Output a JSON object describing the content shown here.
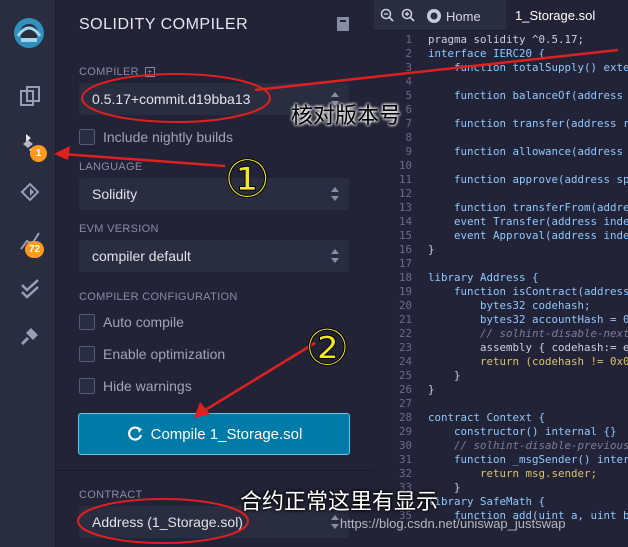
{
  "rail": {
    "badges": {
      "compiler": "1",
      "analysis": "72"
    }
  },
  "panel": {
    "title": "SOLIDITY COMPILER",
    "compiler_label": "COMPILER",
    "compiler_value": "0.5.17+commit.d19bba13",
    "nightly_label": "Include nightly builds",
    "language_label": "LANGUAGE",
    "language_value": "Solidity",
    "evm_label": "EVM VERSION",
    "evm_value": "compiler default",
    "config_label": "COMPILER CONFIGURATION",
    "auto_compile": "Auto compile",
    "optimization": "Enable optimization",
    "hide_warnings": "Hide warnings",
    "compile_button": "Compile 1_Storage.sol",
    "contract_label": "CONTRACT",
    "contract_value": "Address (1_Storage.sol)"
  },
  "editor": {
    "home_tab": "Home",
    "active_tab": "1_Storage.sol",
    "lines": [
      {
        "n": "1",
        "text": "pragma solidity ^0.5.17;",
        "cls": "t"
      },
      {
        "n": "2",
        "text": "interface IERC20 {",
        "cls": "k"
      },
      {
        "n": "3",
        "text": "    function totalSupply() exte",
        "cls": "k"
      },
      {
        "n": "4",
        "text": "",
        "cls": "t"
      },
      {
        "n": "5",
        "text": "    function balanceOf(address",
        "cls": "k"
      },
      {
        "n": "6",
        "text": "",
        "cls": "t"
      },
      {
        "n": "7",
        "text": "    function transfer(address r",
        "cls": "k"
      },
      {
        "n": "8",
        "text": "",
        "cls": "t"
      },
      {
        "n": "9",
        "text": "    function allowance(address",
        "cls": "k"
      },
      {
        "n": "10",
        "text": "",
        "cls": "t"
      },
      {
        "n": "11",
        "text": "    function approve(address sp",
        "cls": "k"
      },
      {
        "n": "12",
        "text": "",
        "cls": "t"
      },
      {
        "n": "13",
        "text": "    function transferFrom(addre",
        "cls": "k"
      },
      {
        "n": "14",
        "text": "    event Transfer(address inde",
        "cls": "k"
      },
      {
        "n": "15",
        "text": "    event Approval(address inde",
        "cls": "k"
      },
      {
        "n": "16",
        "text": "}",
        "cls": "t"
      },
      {
        "n": "17",
        "text": "",
        "cls": "t"
      },
      {
        "n": "18",
        "text": "library Address {",
        "cls": "k"
      },
      {
        "n": "19",
        "text": "    function isContract(address",
        "cls": "k"
      },
      {
        "n": "20",
        "text": "        bytes32 codehash;",
        "cls": "k"
      },
      {
        "n": "21",
        "text": "        bytes32 accountHash = 0",
        "cls": "k"
      },
      {
        "n": "22",
        "text": "        // solhint-disable-next",
        "cls": "c"
      },
      {
        "n": "23",
        "text": "        assembly { codehash:= e",
        "cls": "t"
      },
      {
        "n": "24",
        "text": "        return (codehash != 0x0",
        "cls": "y"
      },
      {
        "n": "25",
        "text": "    }",
        "cls": "t"
      },
      {
        "n": "26",
        "text": "}",
        "cls": "t"
      },
      {
        "n": "27",
        "text": "",
        "cls": "t"
      },
      {
        "n": "28",
        "text": "contract Context {",
        "cls": "k"
      },
      {
        "n": "29",
        "text": "    constructor() internal {}",
        "cls": "k"
      },
      {
        "n": "30",
        "text": "    // solhint-disable-previous",
        "cls": "c"
      },
      {
        "n": "31",
        "text": "    function _msgSender() inter",
        "cls": "k"
      },
      {
        "n": "32",
        "text": "        return msg.sender;",
        "cls": "y"
      },
      {
        "n": "33",
        "text": "    }",
        "cls": "t"
      },
      {
        "n": "34",
        "text": "library SafeMath {",
        "cls": "k"
      },
      {
        "n": "35",
        "text": "    function add(uint a, uint b",
        "cls": "k"
      }
    ]
  },
  "annotations": {
    "note_version": "核对版本号",
    "note_contract": "合约正常这里有显示",
    "mark_1": "①",
    "mark_2": "②"
  },
  "watermark": "https://blog.csdn.net/uniswap_justswap"
}
